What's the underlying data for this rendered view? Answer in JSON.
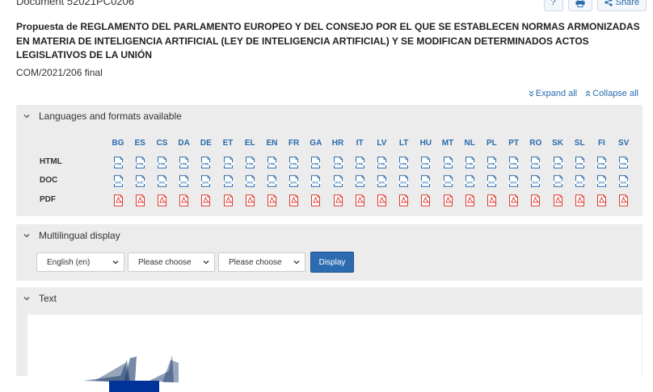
{
  "document_id": "Document 52021PC0206",
  "actions": {
    "help": "?",
    "print": "",
    "share": "Share"
  },
  "title": "Propuesta de REGLAMENTO DEL PARLAMENTO EUROPEO Y DEL CONSEJO POR EL QUE SE ESTABLECEN NORMAS ARMONIZADAS EN MATERIA DE INTELIGENCIA ARTIFICIAL (LEY DE INTELIGENCIA ARTIFICIAL) Y SE MODIFICAN DETERMINADOS ACTOS LEGISLATIVOS DE LA UNIÓN",
  "subtitle": "COM/2021/206 final",
  "expand_all": "Expand all",
  "collapse_all": "Collapse all",
  "languages_panel": {
    "title": "Languages and formats available",
    "languages": [
      "BG",
      "ES",
      "CS",
      "DA",
      "DE",
      "ET",
      "EL",
      "EN",
      "FR",
      "GA",
      "HR",
      "IT",
      "LV",
      "LT",
      "HU",
      "MT",
      "NL",
      "PL",
      "PT",
      "RO",
      "SK",
      "SL",
      "FI",
      "SV"
    ],
    "formats": [
      "HTML",
      "DOC",
      "PDF"
    ],
    "icon_names": [
      "html-file-icon",
      "doc-file-icon",
      "pdf-file-icon"
    ],
    "colors": {
      "link": "#2a6aad",
      "pdf": "#d9392c"
    }
  },
  "multilingual_panel": {
    "title": "Multilingual display",
    "select1": "English (en)",
    "select2": "Please choose",
    "select3": "Please choose",
    "button": "Display"
  },
  "text_panel": {
    "title": "Text"
  }
}
